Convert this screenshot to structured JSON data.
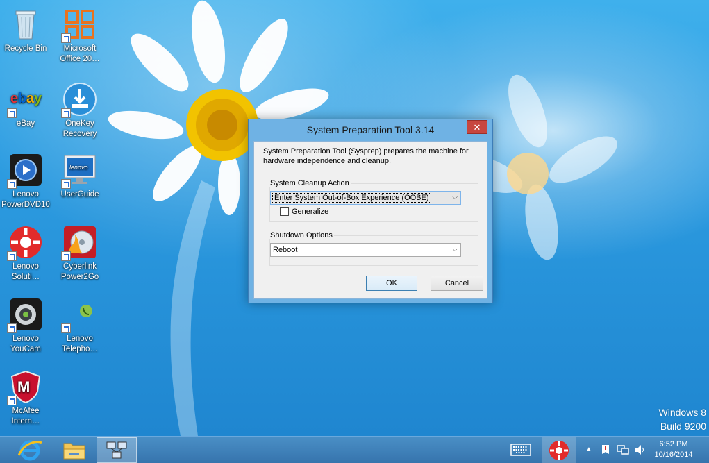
{
  "desktop": {
    "icons": [
      {
        "label": "Recycle Bin",
        "icon": "recycle-bin-icon"
      },
      {
        "label": "Microsoft Office 20…",
        "icon": "office-icon"
      },
      {
        "label": "eBay",
        "icon": "ebay-icon"
      },
      {
        "label": "OneKey Recovery",
        "icon": "onekey-recovery-icon"
      },
      {
        "label": "Lenovo PowerDVD10",
        "icon": "powerdvd-icon"
      },
      {
        "label": "UserGuide",
        "icon": "userguide-icon"
      },
      {
        "label": "Lenovo Soluti…",
        "icon": "lenovo-solutions-icon"
      },
      {
        "label": "Cyberlink Power2Go",
        "icon": "power2go-icon"
      },
      {
        "label": "Lenovo YouCam",
        "icon": "youcam-icon"
      },
      {
        "label": "Lenovo Telepho…",
        "icon": "telephony-icon"
      },
      {
        "label": "McAfee Intern…",
        "icon": "mcafee-icon"
      }
    ],
    "watermark": {
      "line1": "Windows 8",
      "line2": "Build 9200"
    }
  },
  "dialog": {
    "title": "System Preparation Tool 3.14",
    "close_label": "✕",
    "description": "System Preparation Tool (Sysprep) prepares the machine for hardware independence and cleanup.",
    "cleanup_group_label": "System Cleanup Action",
    "cleanup_value": "Enter System Out-of-Box Experience (OOBE)",
    "generalize_label": "Generalize",
    "generalize_checked": false,
    "shutdown_group_label": "Shutdown Options",
    "shutdown_value": "Reboot",
    "ok_label": "OK",
    "cancel_label": "Cancel"
  },
  "taskbar": {
    "pinned": [
      "internet-explorer-icon",
      "file-explorer-icon",
      "sysprep-network-icon"
    ],
    "clock_time": "6:52 PM",
    "clock_date": "10/16/2014",
    "tray_icons": [
      "keyboard-icon",
      "lenovo-solutions-tray-icon",
      "show-hidden-icons-icon",
      "action-center-icon",
      "network-icon",
      "volume-icon"
    ]
  },
  "colors": {
    "desktop_blue": "#2f9ad8",
    "dialog_frame": "#6fb2e4",
    "close_red": "#c7463f",
    "taskbar": "#3d7ab2"
  }
}
